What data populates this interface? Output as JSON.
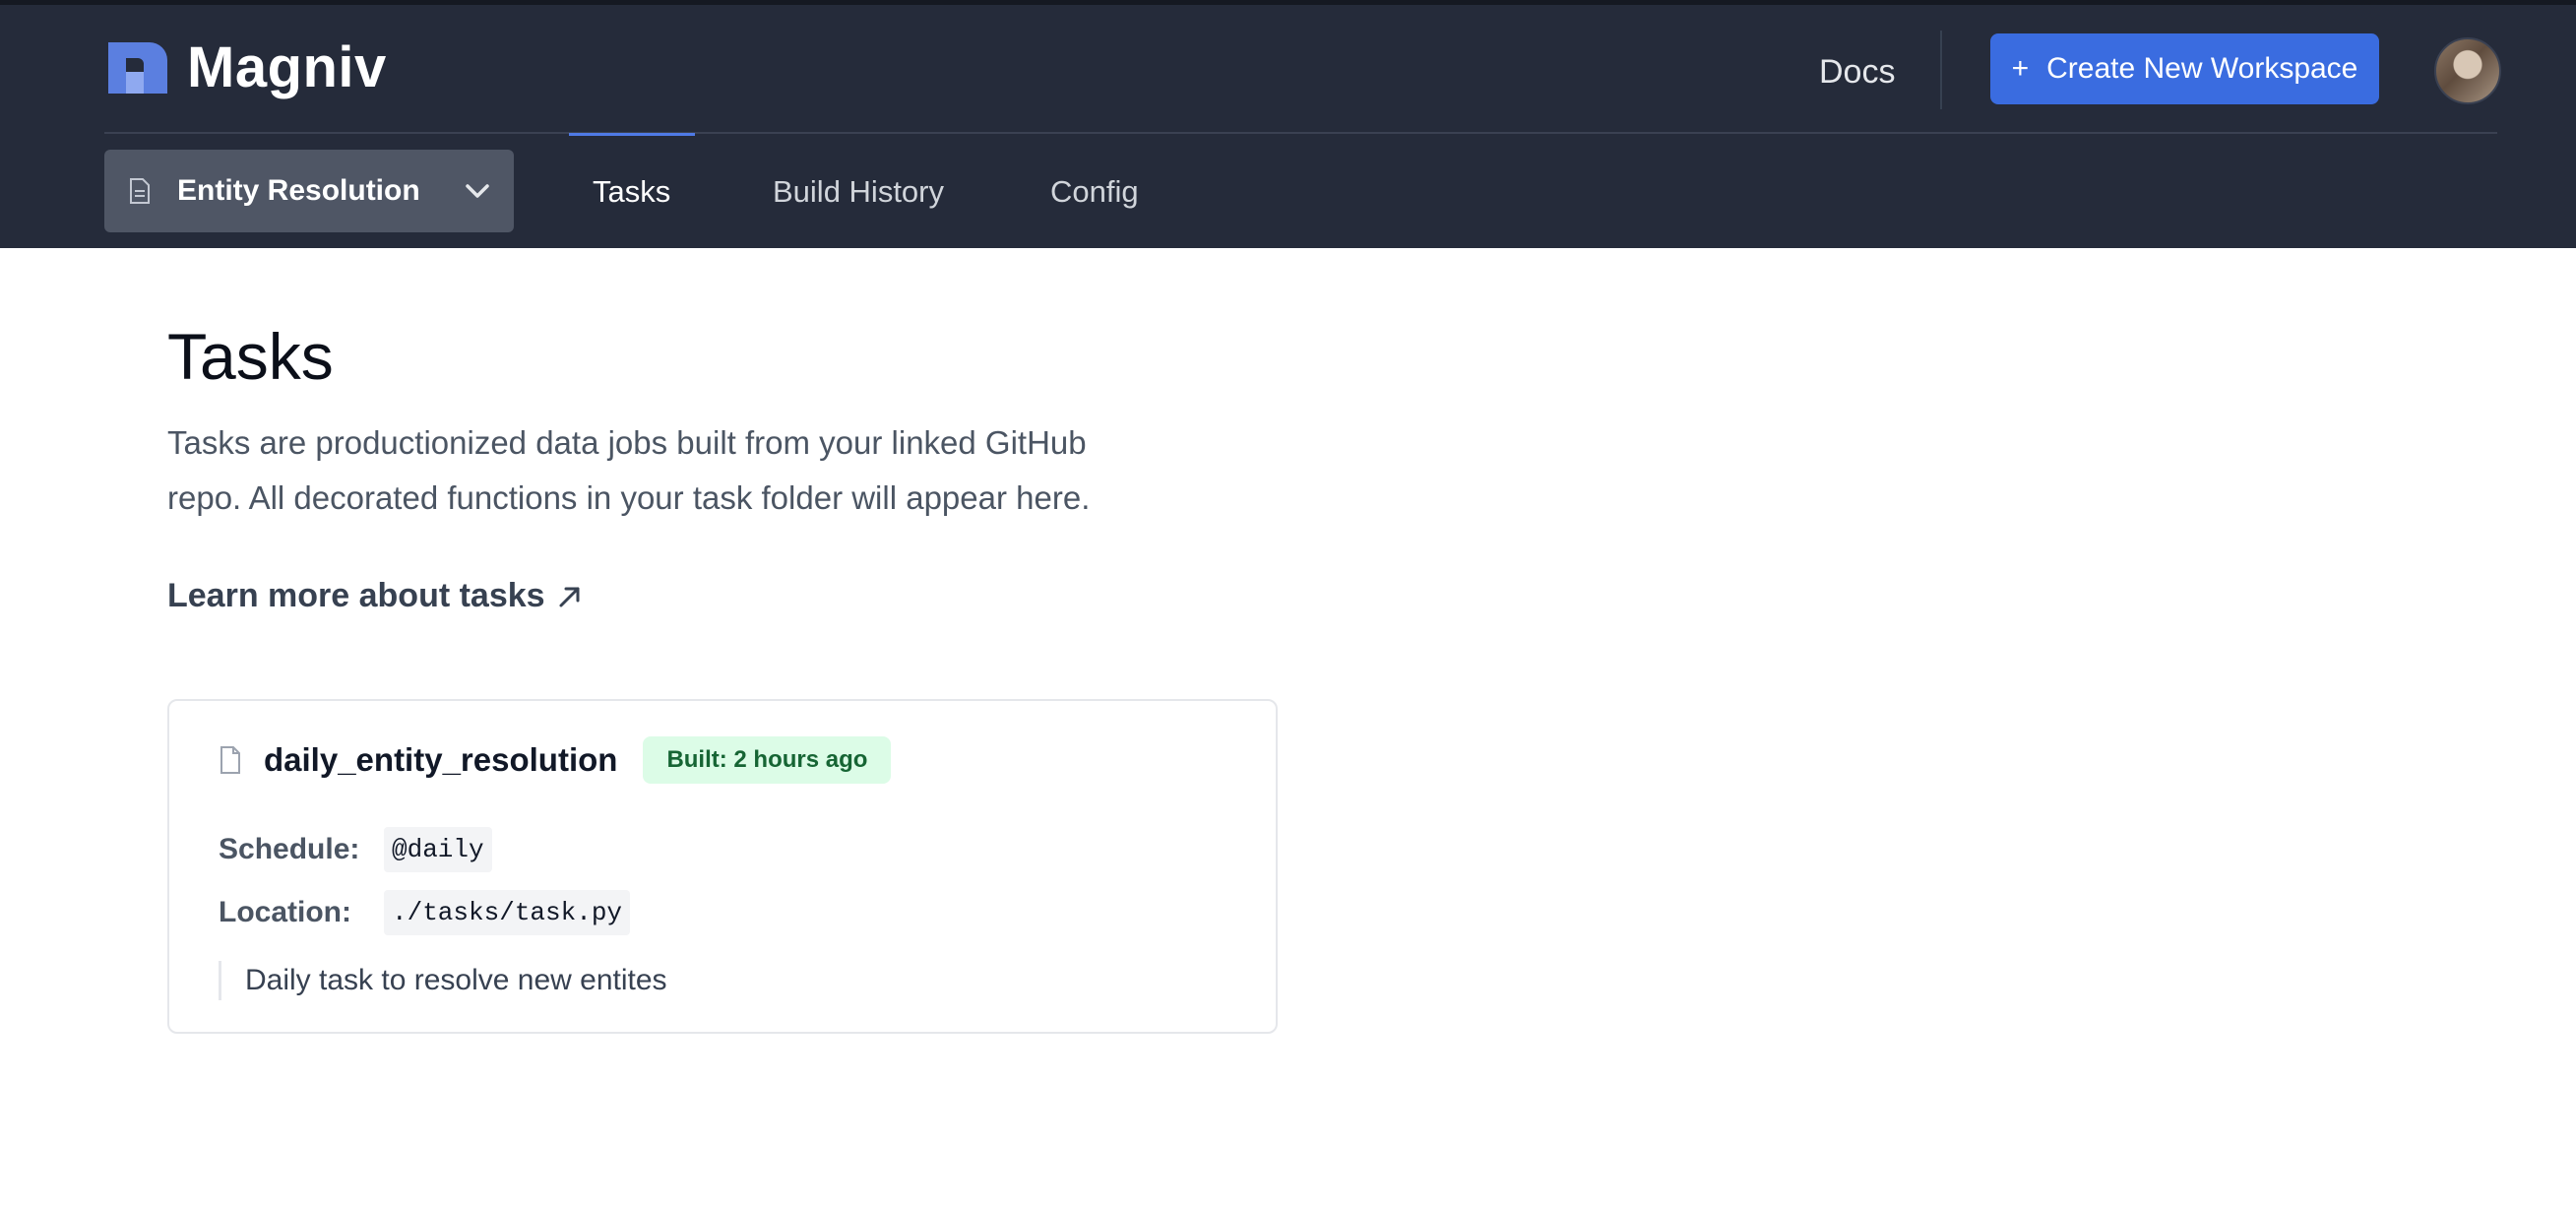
{
  "header": {
    "brand": "Magniv",
    "docs_label": "Docs",
    "create_workspace": {
      "icon": "plus-icon",
      "label": "Create New Workspace"
    },
    "avatar": "user-avatar"
  },
  "workspace_selector": {
    "icon": "document-icon",
    "value": "Entity Resolution",
    "chevron": "chevron-down-icon"
  },
  "tabs": [
    {
      "label": "Tasks",
      "active": true
    },
    {
      "label": "Build History",
      "active": false
    },
    {
      "label": "Config",
      "active": false
    }
  ],
  "main": {
    "title": "Tasks",
    "intro": "Tasks are productionized data jobs built from your linked GitHub repo. All decorated functions in your task folder will appear here.",
    "learn_more": "Learn more about tasks",
    "learn_more_icon": "external-arrow-icon"
  },
  "task_card": {
    "icon": "file-icon",
    "name": "daily_entity_resolution",
    "badge": "Built: 2 hours ago",
    "schedule_label": "Schedule:",
    "schedule_value": "@daily",
    "location_label": "Location:",
    "location_value": "./tasks/task.py",
    "description": "Daily task to resolve new entites"
  },
  "colors": {
    "header_bg": "#252b3a",
    "accent": "#3a6ce0",
    "badge_bg": "#dcfce7",
    "badge_text": "#166534"
  }
}
